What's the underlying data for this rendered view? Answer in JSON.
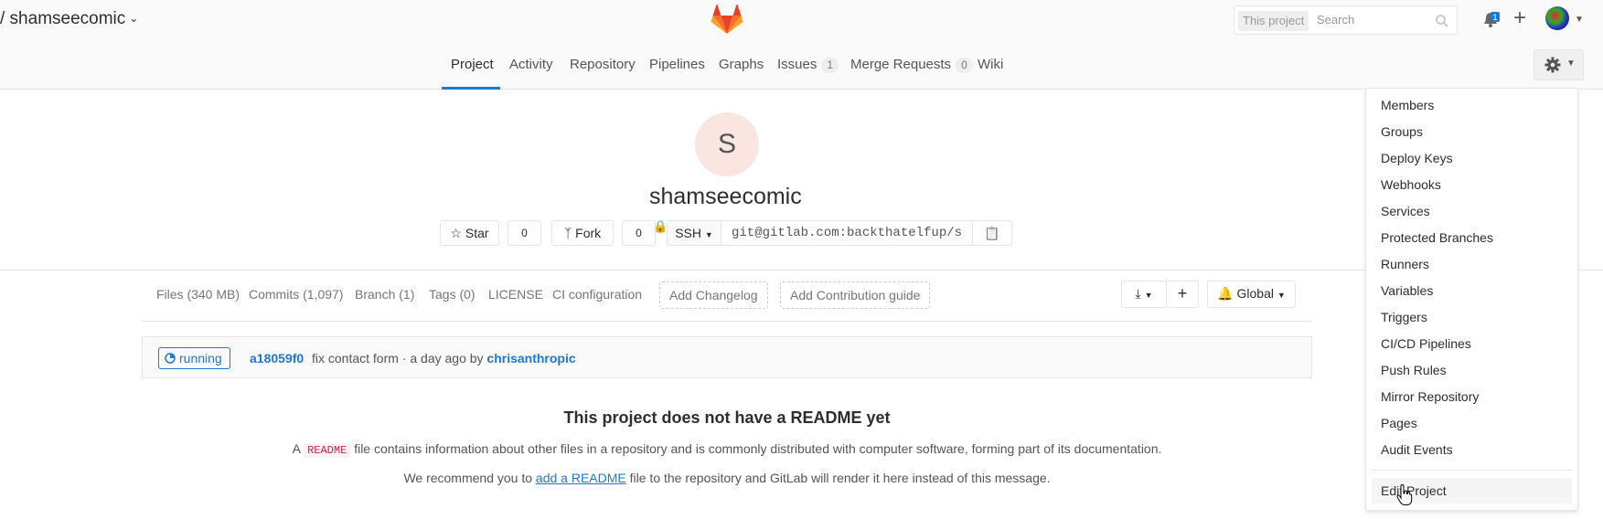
{
  "header": {
    "project_crumb": "/ shamseecomic",
    "search_scope": "This project",
    "search_placeholder": "Search",
    "todos_count": "1"
  },
  "nav": {
    "tabs": [
      {
        "label": "Project"
      },
      {
        "label": "Activity"
      },
      {
        "label": "Repository"
      },
      {
        "label": "Pipelines"
      },
      {
        "label": "Graphs"
      },
      {
        "label": "Issues",
        "count": "1"
      },
      {
        "label": "Merge Requests",
        "count": "0"
      },
      {
        "label": "Wiki"
      }
    ]
  },
  "project": {
    "avatar_letter": "S",
    "name": "shamseecomic",
    "star_label": "Star",
    "star_count": "0",
    "fork_label": "Fork",
    "fork_count": "0",
    "protocol": "SSH",
    "clone_url": "git@gitlab.com:backthatelfup/s"
  },
  "stats": {
    "files": "Files (340 MB)",
    "commits": "Commits (1,097)",
    "branch": "Branch (1)",
    "tags": "Tags (0)",
    "license": "LICENSE",
    "ci": "CI configuration",
    "add_changelog": "Add Changelog",
    "add_contribution": "Add Contribution guide",
    "notification": "Global"
  },
  "pipeline": {
    "status": "running",
    "sha": "a18059f0",
    "message": "fix contact form · a day ago by",
    "author": "chrisanthropic"
  },
  "readme": {
    "title": "This project does not have a README yet",
    "p1_prefix": "A",
    "p1_code": "README",
    "p1_suffix": "file contains information about other files in a repository and is commonly distributed with computer software, forming part of its documentation.",
    "p2_prefix": "We recommend you to",
    "p2_link": "add a README",
    "p2_suffix": "file to the repository and GitLab will render it here instead of this message."
  },
  "settings_menu": {
    "items": [
      "Members",
      "Groups",
      "Deploy Keys",
      "Webhooks",
      "Services",
      "Protected Branches",
      "Runners",
      "Variables",
      "Triggers",
      "CI/CD Pipelines",
      "Push Rules",
      "Mirror Repository",
      "Pages",
      "Audit Events"
    ],
    "edit_project": "Edit Project"
  },
  "colors": {
    "accent": "#1f78d1",
    "gitlab_orange": "#fc6d26"
  }
}
